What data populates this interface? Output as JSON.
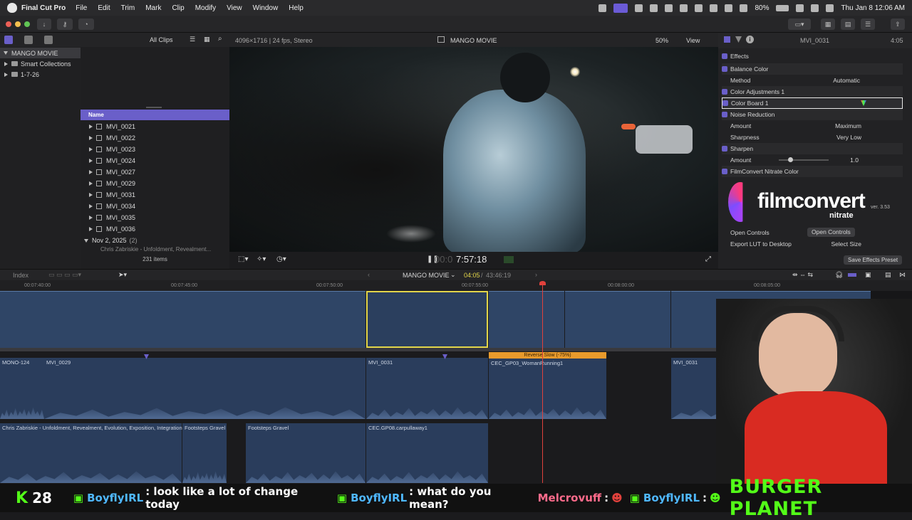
{
  "menubar": {
    "app_name": "Final Cut Pro",
    "items": [
      "File",
      "Edit",
      "Trim",
      "Mark",
      "Clip",
      "Modify",
      "View",
      "Window",
      "Help"
    ],
    "battery": "80%",
    "datetime": "Thu Jan 8  12:06 AM"
  },
  "library": {
    "name": "MANGO MOVIE",
    "items": [
      "Smart Collections",
      "1-7-26"
    ]
  },
  "browser": {
    "filter": "All Clips",
    "column_name": "Name",
    "clips": [
      "MVI_0021",
      "MVI_0022",
      "MVI_0023",
      "MVI_0024",
      "MVI_0027",
      "MVI_0029",
      "MVI_0031",
      "MVI_0034",
      "MVI_0035",
      "MVI_0036"
    ],
    "date_group": "Nov 2, 2025",
    "date_group_count": "(2)",
    "partial_row": "Chris Zabriskie - Unfoldment, Revealment...",
    "item_count": "231 items"
  },
  "viewer": {
    "format": "4096×1716 | 24 fps, Stereo",
    "title": "MANGO MOVIE",
    "zoom": "50%",
    "view_menu": "View",
    "timecode": "7:57:18",
    "timecode_prefix": "00:0"
  },
  "inspector": {
    "clip_name": "MVI_0031",
    "duration": "4:05",
    "effects_label": "Effects",
    "balance_color": "Balance Color",
    "method_label": "Method",
    "method_value": "Automatic",
    "color_adjustments": "Color Adjustments 1",
    "color_board": "Color Board 1",
    "noise_reduction": "Noise Reduction",
    "amount_label": "Amount",
    "amount_value": "Maximum",
    "sharpness_label": "Sharpness",
    "sharpness_value": "Very Low",
    "sharpen": "Sharpen",
    "sharpen_amount_label": "Amount",
    "sharpen_amount_value": "1.0",
    "filmconvert": "FilmConvert Nitrate Color",
    "logo_main": "filmconvert",
    "logo_sub": "nitrate",
    "logo_ver": "ver. 3.53",
    "open_controls_label": "Open Controls",
    "open_controls_button": "Open Controls",
    "export_lut_label": "Export LUT to Desktop",
    "select_size": "Select Size",
    "save_preset": "Save Effects Preset"
  },
  "timeline": {
    "index_label": "Index",
    "project": "MANGO MOVIE",
    "position": "04:05",
    "total": "43:46:19",
    "ruler": [
      "00:07:40:00",
      "00:07:45:00",
      "00:07:50:00",
      "00:07:55:00",
      "00:08:00:00",
      "00:08:05:00"
    ],
    "clip_labels": {
      "mono": "MONO-124",
      "mvi29": "MVI_0029",
      "mvi31a": "MVI_0031",
      "retime": "Reverse Slow (-75%)",
      "woman": "CEC_GP03_WomanRunning1",
      "mvi31b": "MVI_0031",
      "music": "Chris Zabriskie - Unfoldment, Revealment, Evolution, Exposition, Integration, A...",
      "foot1": "Footsteps Gravel",
      "foot2": "Footsteps Gravel",
      "carpull": "CEC.GP08.carpullaway1"
    }
  },
  "chat": {
    "kick_count": "28",
    "messages": [
      {
        "user": "BoyflyIRL",
        "text": ": look like a lot of change today"
      },
      {
        "user": "BoyflyIRL",
        "text": ": what do you mean?"
      },
      {
        "user": "Melcrovuff",
        "text": ":"
      },
      {
        "user": "BoyflyIRL",
        "text": ":"
      }
    ],
    "banner": "BURGER PLANET"
  },
  "colors": {
    "accent": "#6a5fc9",
    "clip_blue": "#2f4566",
    "selection": "#e3d64a",
    "playhead": "#e0413c",
    "retime": "#e89a2c",
    "kick_green": "#53fc18"
  }
}
